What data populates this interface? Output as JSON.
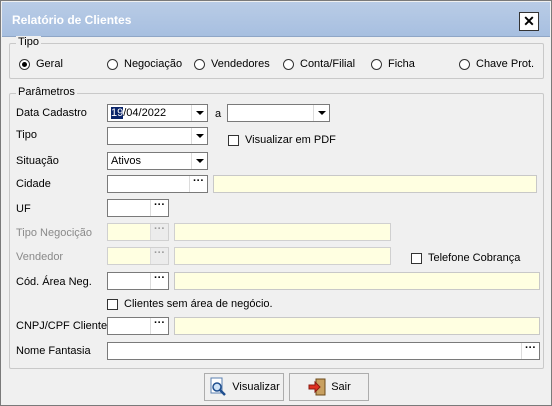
{
  "window": {
    "title": "Relatório de Clientes",
    "close_symbol": "✕"
  },
  "tipo": {
    "legend": "Tipo",
    "options": [
      "Geral",
      "Negociação",
      "Vendedores",
      "Conta/Filial",
      "Ficha",
      "Chave Prot."
    ],
    "selected": "Geral"
  },
  "parametros": {
    "legend": "Parâmetros",
    "data_cadastro": {
      "label": "Data Cadastro",
      "value_sel": "19",
      "value_rest": "/04/2022",
      "separator": "a",
      "to_value": ""
    },
    "tipo": {
      "label": "Tipo",
      "value": ""
    },
    "visualizar_pdf": {
      "label": "Visualizar em PDF",
      "checked": false
    },
    "situacao": {
      "label": "Situação",
      "value": "Ativos"
    },
    "cidade": {
      "label": "Cidade",
      "code": "",
      "name": ""
    },
    "uf": {
      "label": "UF",
      "value": ""
    },
    "tipo_negociacao": {
      "label": "Tipo Negocição",
      "code": "",
      "name": ""
    },
    "vendedor": {
      "label": "Vendedor",
      "code": "",
      "name": ""
    },
    "telefone_cobranca": {
      "label": "Telefone Cobrança",
      "checked": false
    },
    "cod_area_neg": {
      "label": "Cód. Área  Neg.",
      "code": "",
      "name": ""
    },
    "clientes_sem_area": {
      "label": "Clientes sem área de negócio.",
      "checked": false
    },
    "cnpj_cpf": {
      "label": "CNPJ/CPF Cliente",
      "code": "",
      "name": ""
    },
    "nome_fantasia": {
      "label": "Nome Fantasia",
      "value": ""
    }
  },
  "buttons": {
    "visualizar": "Visualizar",
    "sair": "Sair"
  },
  "ellipsis": "···",
  "colors": {
    "titlebar": "#a7bfe0",
    "lookup_field": "#ffffe1",
    "selection": "#0a246a"
  }
}
